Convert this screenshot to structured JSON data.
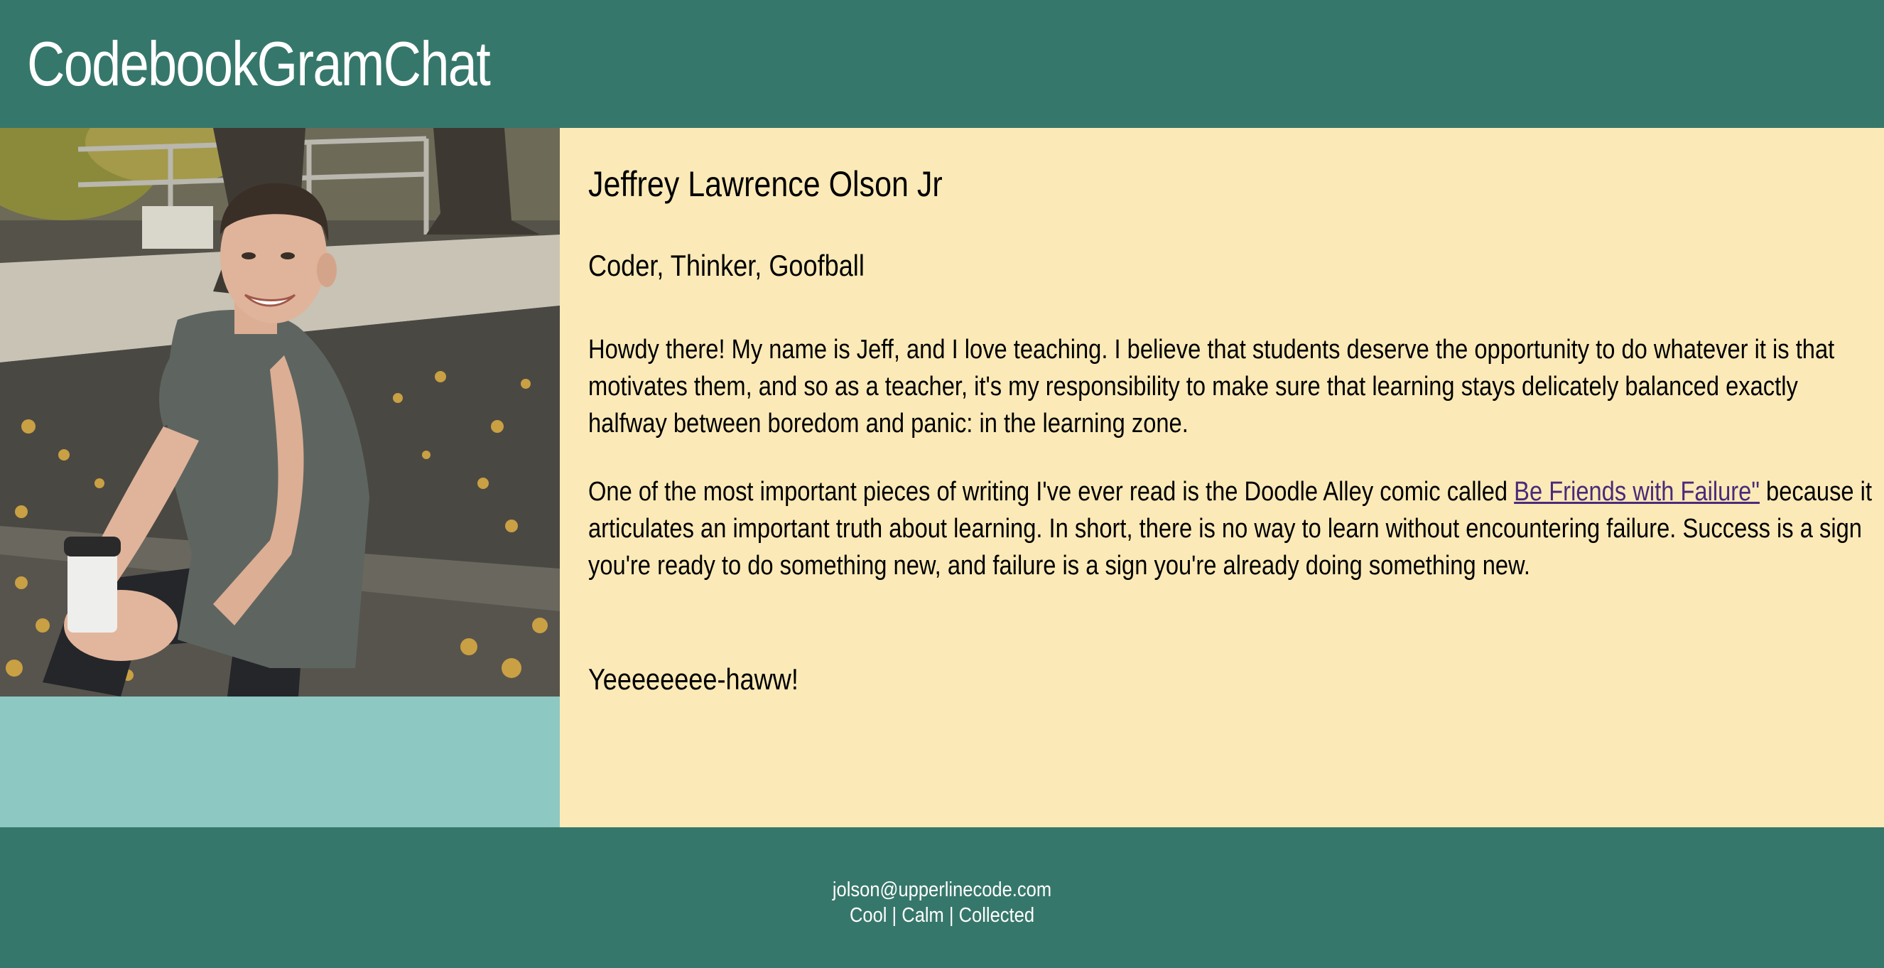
{
  "site": {
    "title": "CodebookGramChat"
  },
  "profile": {
    "name": "Jeffrey Lawrence Olson Jr",
    "tagline": "Coder, Thinker, Goofball",
    "bio_paragraph_1": "Howdy there! My name is Jeff, and I love teaching. I believe that students deserve the opportunity to do whatever it is that motivates them, and so as a teacher, it's my responsibility to make sure that learning stays delicately balanced exactly halfway between boredom and panic: in the learning zone.",
    "bio_paragraph_2_before_link": "One of the most important pieces of writing I've ever read is the Doodle Alley comic called ",
    "bio_link_text": "Be Friends with Failure\"",
    "bio_paragraph_2_after_link": " because it articulates an important truth about learning. In short, there is no way to learn without encountering failure. Success is a sign you're ready to do something new, and failure is a sign you're already doing something new.",
    "signoff": "Yeeeeeeee-haww!"
  },
  "photo": {
    "icon": "profile-photo"
  },
  "footer": {
    "email": "jolson@upperlinecode.com",
    "motto": "Cool | Calm | Collected"
  },
  "colors": {
    "header_bg": "#36776b",
    "sidebar_bg": "#8ec8c2",
    "main_bg": "#fbeab7",
    "link": "#4a2a7a"
  }
}
